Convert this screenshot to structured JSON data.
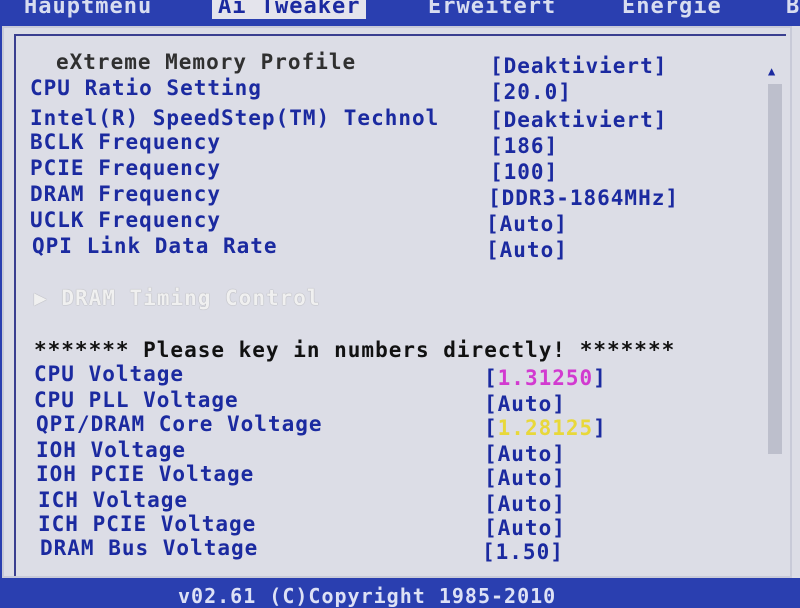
{
  "tabs": [
    {
      "label": "Hauptmenü"
    },
    {
      "label": "Ai Tweaker"
    },
    {
      "label": "Erweitert"
    },
    {
      "label": "Energie"
    },
    {
      "label": "B"
    }
  ],
  "settings": [
    {
      "label": "eXtreme Memory Profile",
      "value": "[Deaktiviert]"
    },
    {
      "label": "CPU Ratio Setting",
      "value": "[20.0]"
    },
    {
      "label": "Intel(R) SpeedStep(TM) Technol",
      "value": "[Deaktiviert]"
    },
    {
      "label": "BCLK Frequency",
      "value": "[186]"
    },
    {
      "label": "PCIE Frequency",
      "value": "[100]"
    },
    {
      "label": "DRAM Frequency",
      "value": "[DDR3-1864MHz]"
    },
    {
      "label": "UCLK Frequency",
      "value": "[Auto]"
    },
    {
      "label": "QPI Link Data Rate",
      "value": "[Auto]"
    }
  ],
  "submenu": {
    "arrow": "▶",
    "label": "DRAM Timing Control"
  },
  "note": "******* Please key in numbers directly! *******",
  "voltages": [
    {
      "label": "CPU Voltage",
      "value": "1.31250",
      "color": "#d23ad0"
    },
    {
      "label": "CPU PLL Voltage",
      "value": "[Auto]"
    },
    {
      "label": "QPI/DRAM Core Voltage",
      "value": "1.28125",
      "color": "#e8d83a"
    },
    {
      "label": "IOH Voltage",
      "value": "[Auto]"
    },
    {
      "label": "IOH PCIE Voltage",
      "value": "[Auto]"
    },
    {
      "label": "ICH Voltage",
      "value": "[Auto]"
    },
    {
      "label": "ICH PCIE Voltage",
      "value": "[Auto]"
    },
    {
      "label": "DRAM Bus Voltage",
      "value": "[1.50]"
    }
  ],
  "footer": "v02.61 (C)Copyright 1985-2010"
}
